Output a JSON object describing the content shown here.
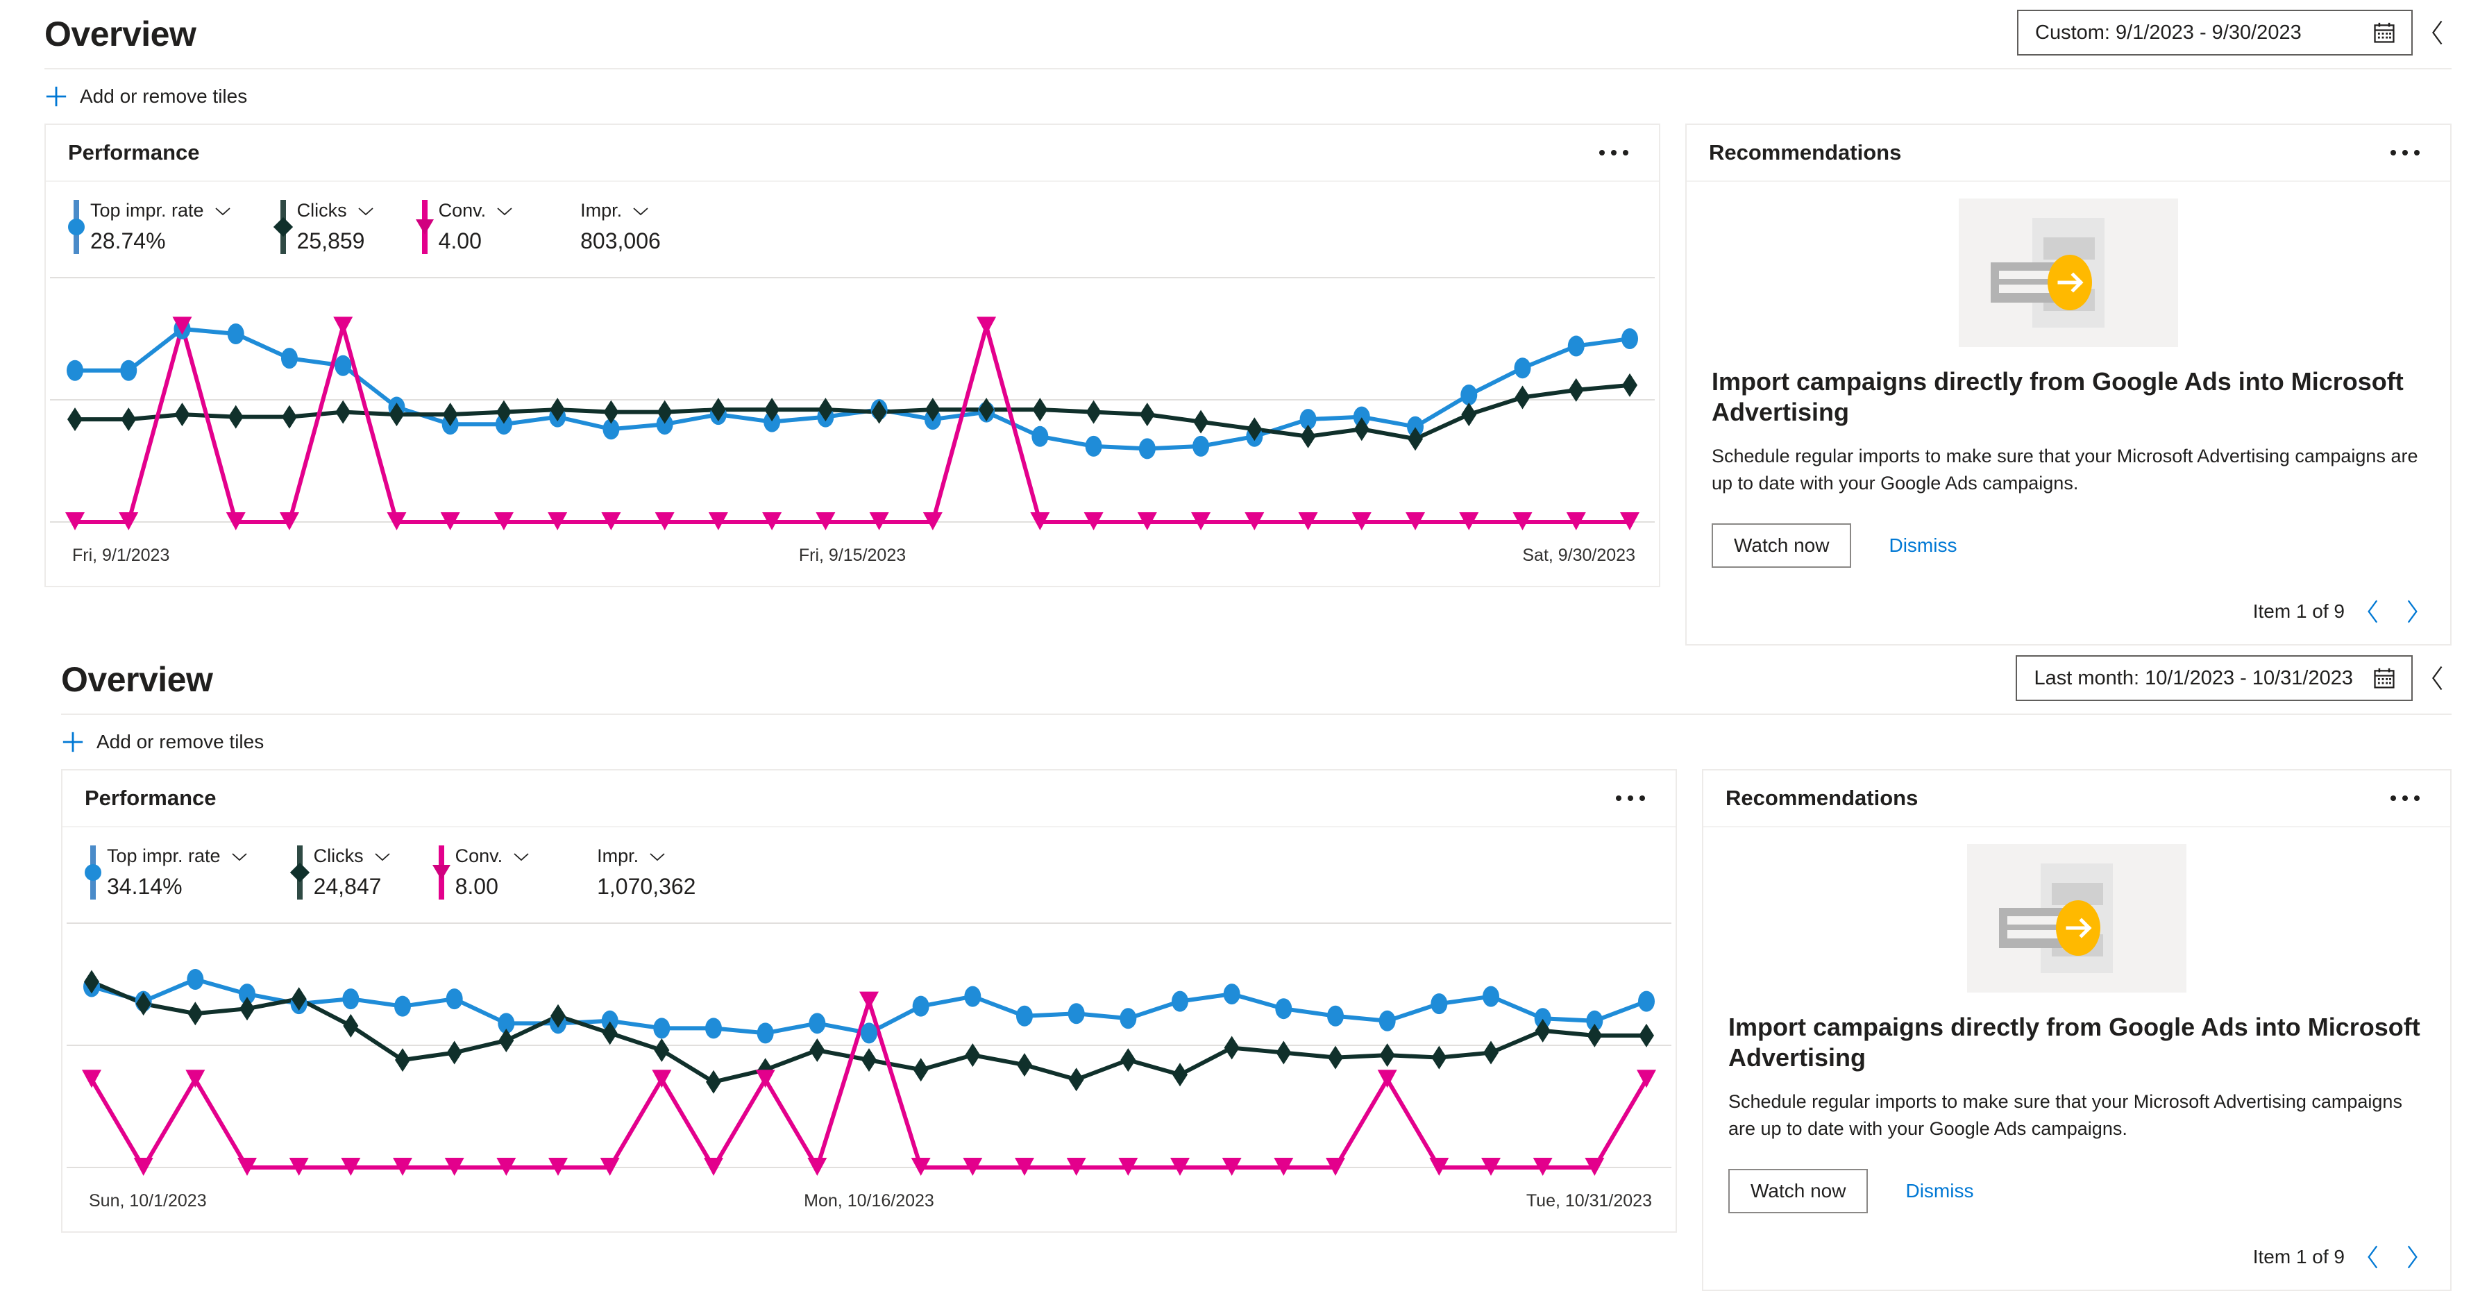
{
  "sections": [
    {
      "title": "Overview",
      "date_picker": {
        "value": "Custom: 9/1/2023 - 9/30/2023",
        "icon": "calendar-icon"
      },
      "toolbar": {
        "add_tiles_label": "Add or remove tiles",
        "icon": "plus-icon"
      },
      "performance": {
        "card_title": "Performance",
        "menu_icon": "ellipsis-icon",
        "metrics": [
          {
            "label": "Top impr. rate",
            "value": "28.74%",
            "color": "#4a8bc9",
            "marker": "circle"
          },
          {
            "label": "Clicks",
            "value": "25,859",
            "color": "#10302b",
            "marker": "diamond"
          },
          {
            "label": "Conv.",
            "value": "4.00",
            "color": "#e3008c",
            "marker": "triangle"
          },
          {
            "label": "Impr.",
            "value": "803,006",
            "color": "#transparent",
            "marker": "none"
          }
        ],
        "axis": {
          "left": "Fri, 9/1/2023",
          "middle": "Fri, 9/15/2023",
          "right": "Sat, 9/30/2023"
        }
      },
      "recommendations": {
        "card_title": "Recommendations",
        "menu_icon": "ellipsis-icon",
        "illustration": "import-campaigns-illustration",
        "title": "Import campaigns directly from Google Ads into Microsoft Advertising",
        "description": "Schedule regular imports to make sure that your Microsoft Advertising campaigns are up to date with your Google Ads campaigns.",
        "primary_button": "Watch now",
        "secondary_link": "Dismiss",
        "pager_text": "Item 1 of 9"
      }
    },
    {
      "title": "Overview",
      "date_picker": {
        "value": "Last month: 10/1/2023 - 10/31/2023",
        "icon": "calendar-icon"
      },
      "toolbar": {
        "add_tiles_label": "Add or remove tiles",
        "icon": "plus-icon"
      },
      "performance": {
        "card_title": "Performance",
        "menu_icon": "ellipsis-icon",
        "metrics": [
          {
            "label": "Top impr. rate",
            "value": "34.14%",
            "color": "#4a8bc9",
            "marker": "circle"
          },
          {
            "label": "Clicks",
            "value": "24,847",
            "color": "#10302b",
            "marker": "diamond"
          },
          {
            "label": "Conv.",
            "value": "8.00",
            "color": "#e3008c",
            "marker": "triangle"
          },
          {
            "label": "Impr.",
            "value": "1,070,362",
            "color": "#transparent",
            "marker": "none"
          }
        ],
        "axis": {
          "left": "Sun, 10/1/2023",
          "middle": "Mon, 10/16/2023",
          "right": "Tue, 10/31/2023"
        }
      },
      "recommendations": {
        "card_title": "Recommendations",
        "menu_icon": "ellipsis-icon",
        "illustration": "import-campaigns-illustration",
        "title": "Import campaigns directly from Google Ads into Microsoft Advertising",
        "description": "Schedule regular imports to make sure that your Microsoft Advertising campaigns are up to date with your Google Ads campaigns.",
        "primary_button": "Watch now",
        "secondary_link": "Dismiss",
        "pager_text": "Item 1 of 9"
      }
    }
  ],
  "colors": {
    "top_impr_rate": "#1f8cd8",
    "clicks": "#10302b",
    "conversions": "#e3008c",
    "accent_link": "#0078d4",
    "card_border": "#edebe9",
    "gridline": "#e1dfdd",
    "illustration_accent": "#ffb900"
  },
  "chart_data": [
    {
      "type": "line",
      "title": "Performance",
      "xlabel": "",
      "ylabel": "",
      "grid": true,
      "legend_position": "top",
      "x": [
        "9/1",
        "9/2",
        "9/3",
        "9/4",
        "9/5",
        "9/6",
        "9/7",
        "9/8",
        "9/9",
        "9/10",
        "9/11",
        "9/12",
        "9/13",
        "9/14",
        "9/15",
        "9/16",
        "9/17",
        "9/18",
        "9/19",
        "9/20",
        "9/21",
        "9/22",
        "9/23",
        "9/24",
        "9/25",
        "9/26",
        "9/27",
        "9/28",
        "9/29",
        "9/30"
      ],
      "xtick_labels": [
        "Fri, 9/1/2023",
        "Fri, 9/15/2023",
        "Sat, 9/30/2023"
      ],
      "ylim": [
        0,
        100
      ],
      "series": [
        {
          "name": "Top impr. rate",
          "color": "#1f8cd8",
          "marker": "circle",
          "values": [
            62,
            62,
            79,
            77,
            67,
            64,
            47,
            40,
            40,
            43,
            38,
            40,
            44,
            41,
            43,
            46,
            42,
            45,
            35,
            31,
            30,
            31,
            35,
            42,
            43,
            39,
            52,
            63,
            72,
            75
          ]
        },
        {
          "name": "Clicks",
          "color": "#10302b",
          "marker": "diamond",
          "values": [
            42,
            42,
            44,
            43,
            43,
            45,
            44,
            44,
            45,
            46,
            45,
            45,
            46,
            46,
            46,
            45,
            46,
            46,
            46,
            45,
            44,
            41,
            38,
            35,
            38,
            34,
            44,
            51,
            54,
            56
          ]
        },
        {
          "name": "Conv.",
          "color": "#e3008c",
          "marker": "triangle",
          "values": [
            0,
            0,
            80,
            0,
            0,
            80,
            0,
            0,
            0,
            0,
            0,
            0,
            0,
            0,
            0,
            0,
            0,
            80,
            0,
            0,
            0,
            0,
            0,
            0,
            0,
            0,
            0,
            0,
            0,
            0
          ]
        }
      ]
    },
    {
      "type": "line",
      "title": "Performance",
      "xlabel": "",
      "ylabel": "",
      "grid": true,
      "legend_position": "top",
      "x": [
        "10/1",
        "10/2",
        "10/3",
        "10/4",
        "10/5",
        "10/6",
        "10/7",
        "10/8",
        "10/9",
        "10/10",
        "10/11",
        "10/12",
        "10/13",
        "10/14",
        "10/15",
        "10/16",
        "10/17",
        "10/18",
        "10/19",
        "10/20",
        "10/21",
        "10/22",
        "10/23",
        "10/24",
        "10/25",
        "10/26",
        "10/27",
        "10/28",
        "10/29",
        "10/30",
        "10/31"
      ],
      "xtick_labels": [
        "Sun, 10/1/2023",
        "Mon, 10/16/2023",
        "Tue, 10/31/2023"
      ],
      "ylim": [
        0,
        100
      ],
      "series": [
        {
          "name": "Top impr. rate",
          "color": "#1f8cd8",
          "marker": "circle",
          "values": [
            74,
            68,
            77,
            71,
            67,
            69,
            66,
            69,
            59,
            59,
            60,
            57,
            57,
            55,
            59,
            55,
            66,
            70,
            62,
            63,
            61,
            68,
            71,
            65,
            62,
            60,
            67,
            70,
            61,
            60,
            68
          ]
        },
        {
          "name": "Clicks",
          "color": "#10302b",
          "marker": "diamond",
          "values": [
            76,
            67,
            63,
            65,
            69,
            58,
            44,
            47,
            52,
            62,
            55,
            48,
            35,
            40,
            48,
            44,
            40,
            46,
            42,
            36,
            44,
            38,
            49,
            47,
            45,
            46,
            45,
            47,
            56,
            54,
            54
          ]
        },
        {
          "name": "Conv.",
          "color": "#e3008c",
          "marker": "triangle",
          "values": [
            36,
            0,
            36,
            0,
            0,
            0,
            0,
            0,
            0,
            0,
            0,
            36,
            0,
            36,
            0,
            68,
            0,
            0,
            0,
            0,
            0,
            0,
            0,
            0,
            0,
            36,
            0,
            0,
            0,
            0,
            36
          ]
        }
      ]
    }
  ]
}
